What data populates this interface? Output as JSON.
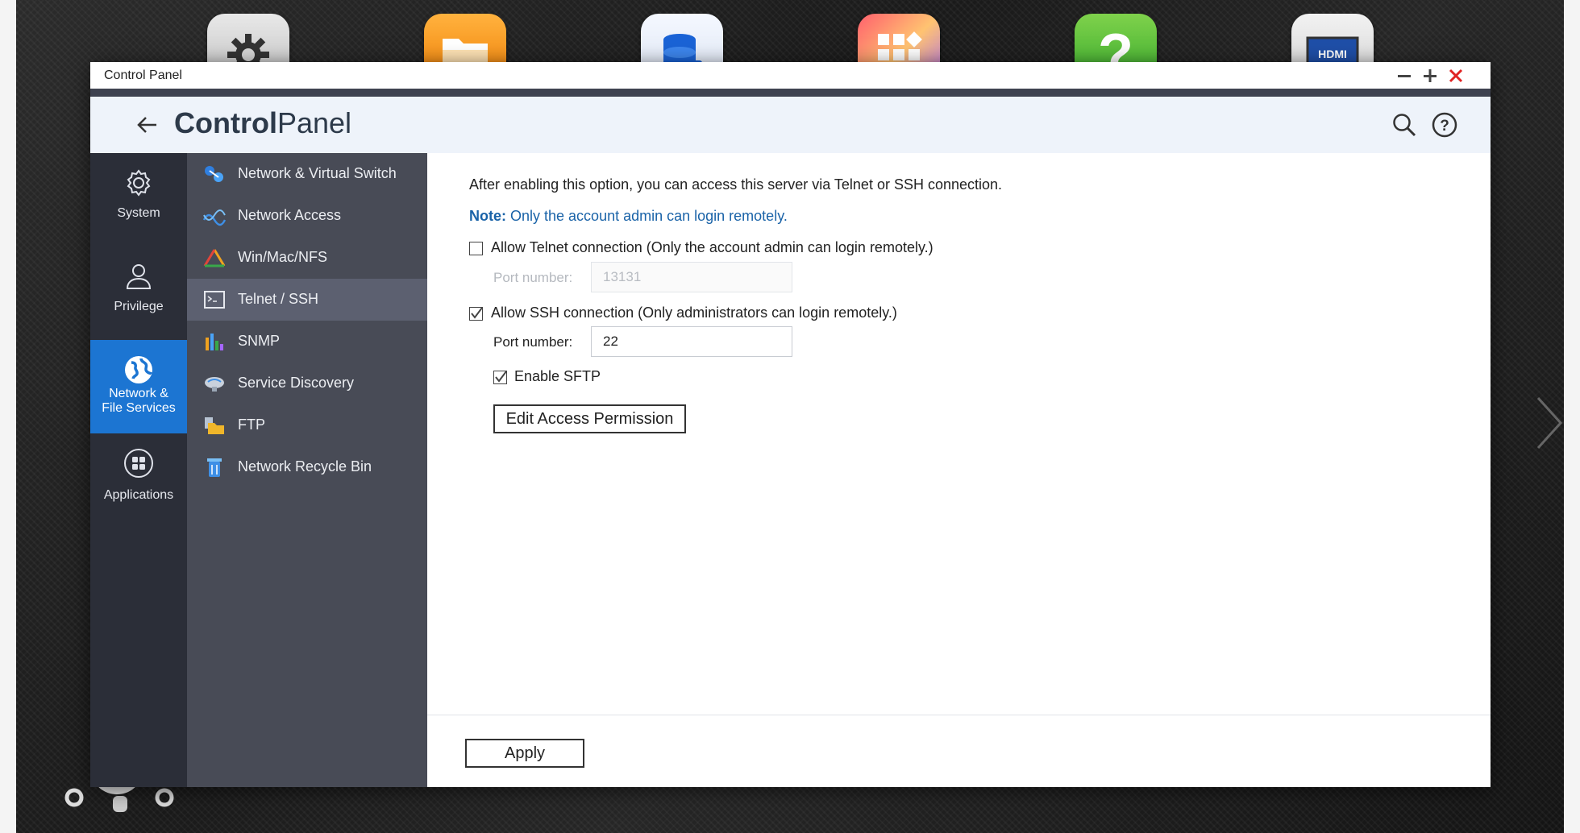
{
  "window": {
    "title": "Control Panel"
  },
  "header": {
    "title_bold": "Control",
    "title_light": "Panel"
  },
  "rail": [
    {
      "label": "System",
      "icon": "gear-icon"
    },
    {
      "label": "Privilege",
      "icon": "user-icon"
    },
    {
      "label": "Network & File Services",
      "icon": "globe-icon",
      "active": true
    },
    {
      "label": "Applications",
      "icon": "apps-icon"
    }
  ],
  "subnav": [
    {
      "label": "Network & Virtual Switch",
      "icon": "network-switch-icon"
    },
    {
      "label": "Network Access",
      "icon": "network-access-icon"
    },
    {
      "label": "Win/Mac/NFS",
      "icon": "win-mac-nfs-icon"
    },
    {
      "label": "Telnet / SSH",
      "icon": "terminal-icon",
      "active": true
    },
    {
      "label": "SNMP",
      "icon": "snmp-chart-icon"
    },
    {
      "label": "Service Discovery",
      "icon": "service-discovery-icon"
    },
    {
      "label": "FTP",
      "icon": "ftp-folder-icon"
    },
    {
      "label": "Network Recycle Bin",
      "icon": "recycle-bin-icon"
    }
  ],
  "content": {
    "intro": "After enabling this option, you can access this server via Telnet or SSH connection.",
    "note_label": "Note:",
    "note_text": "Only the account admin can login remotely.",
    "telnet": {
      "label": "Allow Telnet connection (Only the account admin can login remotely.)",
      "checked": false,
      "port_label": "Port number:",
      "port_value": "13131"
    },
    "ssh": {
      "label": "Allow SSH connection (Only administrators can login remotely.)",
      "checked": true,
      "port_label": "Port number:",
      "port_value": "22"
    },
    "sftp": {
      "label": "Enable SFTP",
      "checked": true
    },
    "edit_button": "Edit Access Permission",
    "apply_button": "Apply"
  },
  "dock": [
    {
      "icon": "settings-app-icon"
    },
    {
      "icon": "file-station-icon"
    },
    {
      "icon": "storage-app-icon"
    },
    {
      "icon": "app-center-icon"
    },
    {
      "icon": "help-app-icon"
    },
    {
      "icon": "hdmi-app-icon"
    }
  ],
  "colors": {
    "accent": "#1c75d2",
    "rail_bg": "#2b2e38",
    "subnav_bg": "#484b56",
    "note": "#1a63a8"
  }
}
